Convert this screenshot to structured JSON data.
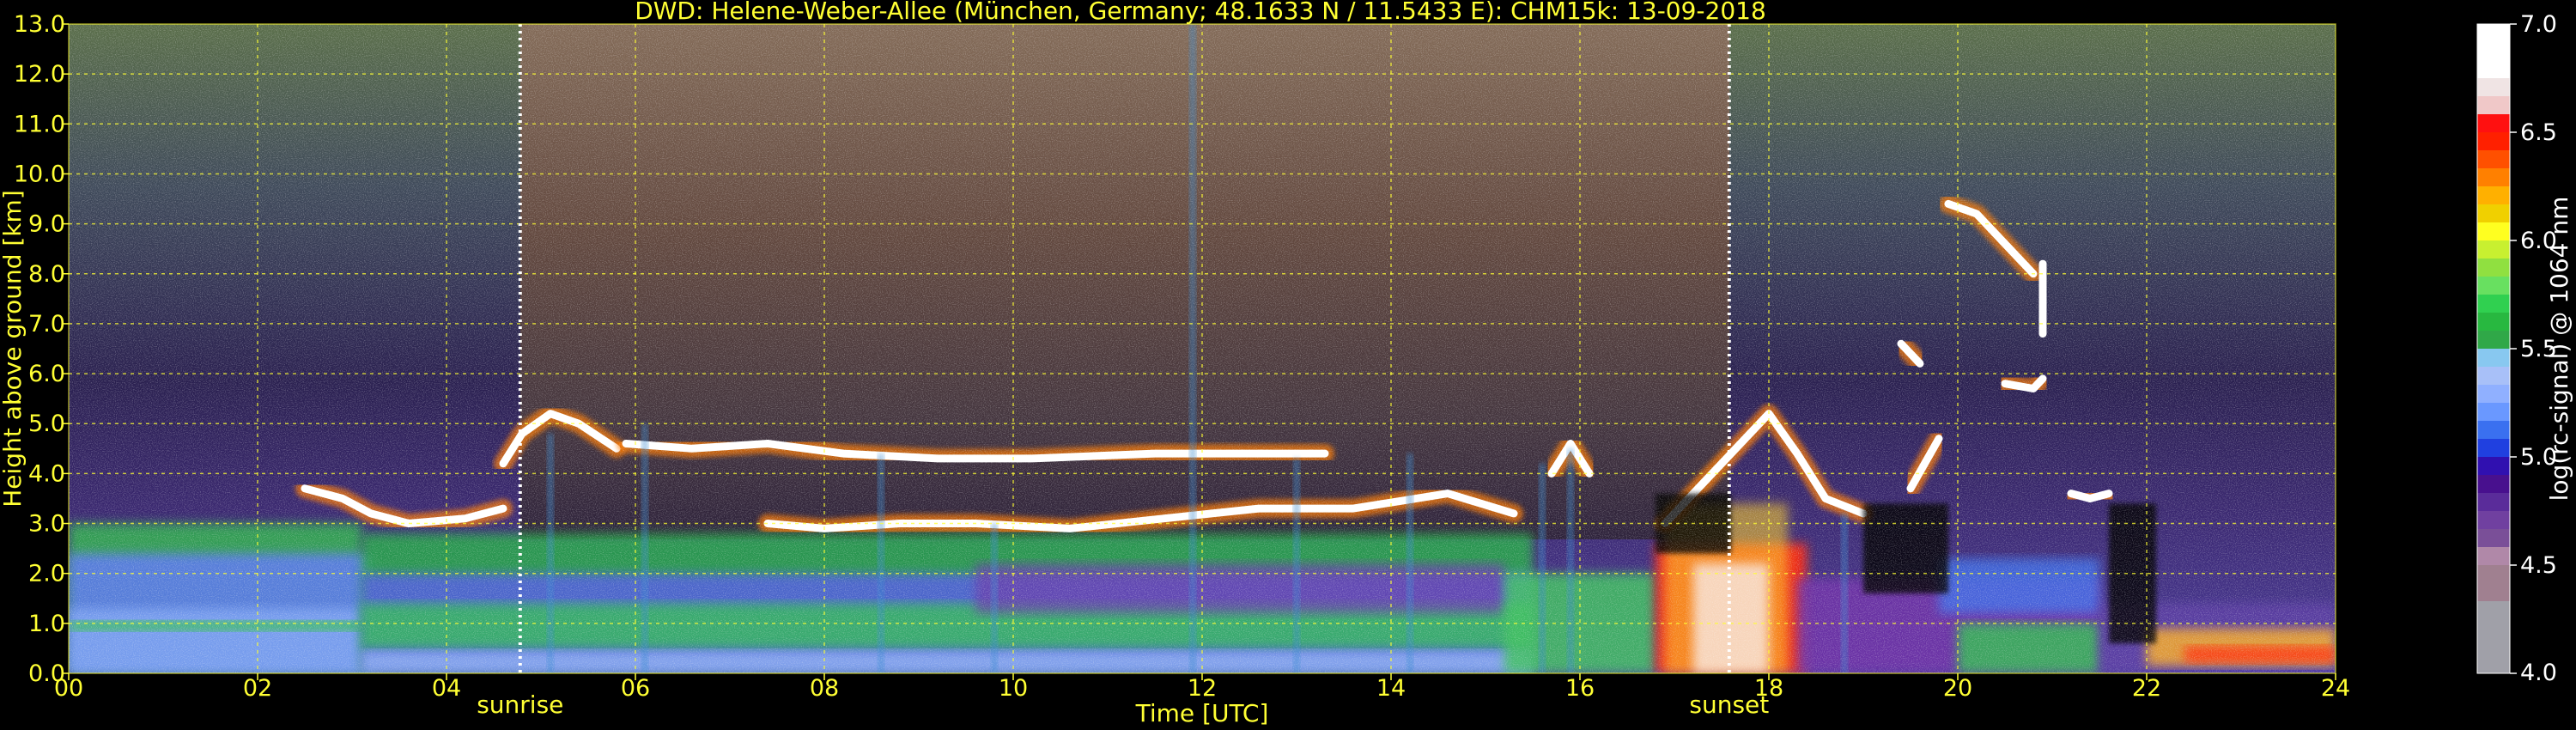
{
  "chart_data": {
    "type": "heatmap",
    "title": "DWD: Helene-Weber-Allee (München, Germany; 48.1633 N / 11.5433 E):    CHM15k: 13-09-2018",
    "xlabel": "Time [UTC]",
    "ylabel": "Height above ground [km]",
    "xlim": [
      0,
      24
    ],
    "ylim": [
      0,
      13
    ],
    "x_ticks": [
      "00",
      "02",
      "04",
      "06",
      "08",
      "10",
      "12",
      "14",
      "16",
      "18",
      "20",
      "22",
      "24"
    ],
    "y_ticks": [
      "0.0",
      "1.0",
      "2.0",
      "3.0",
      "4.0",
      "5.0",
      "6.0",
      "7.0",
      "8.0",
      "9.0",
      "10.0",
      "11.0",
      "12.0",
      "13.0"
    ],
    "grid": true,
    "annotations": [
      {
        "label": "sunrise",
        "x": 4.78
      },
      {
        "label": "sunset",
        "x": 17.58
      }
    ],
    "colorbar": {
      "label": "log(rc-signal) @ 1064 nm",
      "range": [
        4.0,
        7.0
      ],
      "ticks": [
        "4.0",
        "4.5",
        "5.0",
        "5.5",
        "6.0",
        "6.5",
        "7.0"
      ],
      "colors": [
        "#a0a0a8",
        "#a0a0a8",
        "#a0a0a8",
        "#a0a0a8",
        "#a08090",
        "#a08090",
        "#b088a8",
        "#7a4f98",
        "#7040a0",
        "#5a2c9a",
        "#48108e",
        "#3010b0",
        "#2040e0",
        "#3a70f0",
        "#6a98ff",
        "#90b0ff",
        "#a8c0f8",
        "#88c8f0",
        "#30a848",
        "#28b840",
        "#30d050",
        "#68e060",
        "#90e040",
        "#c8f030",
        "#ffff20",
        "#f0d000",
        "#ffb000",
        "#ff8000",
        "#ff5000",
        "#ff2000",
        "#ff1010",
        "#f0c8c8",
        "#f0e4e4",
        "#ffffff",
        "#ffffff",
        "#ffffff"
      ]
    }
  }
}
